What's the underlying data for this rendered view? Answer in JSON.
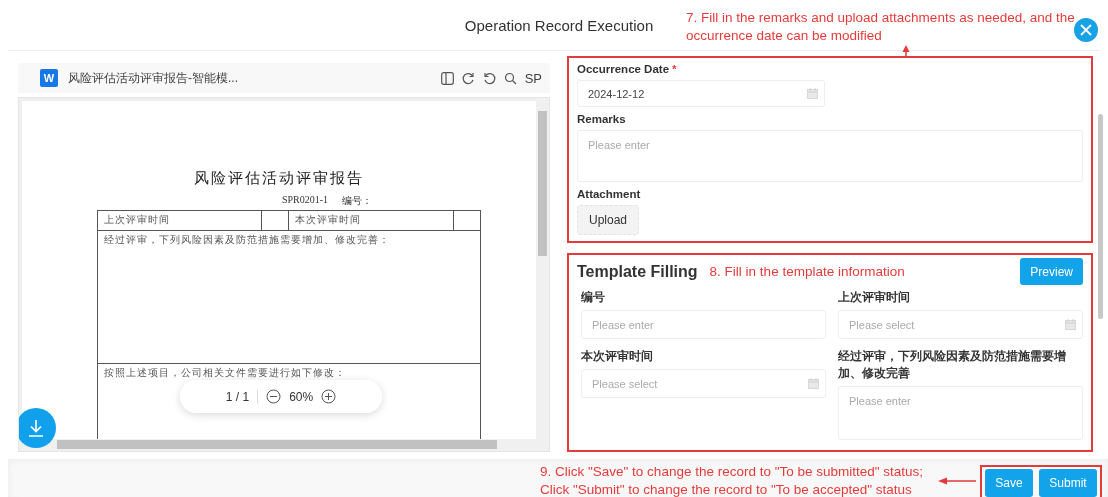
{
  "header": {
    "title": "Operation Record Execution",
    "annotation": [
      "7. Fill in the remarks and upload attachments as needed, and the",
      "occurrence date can be modified"
    ]
  },
  "viewer": {
    "file_icon_letter": "W",
    "file_name": "风险评估活动评审报告-智能模...",
    "toolbar_text": "SP",
    "document": {
      "title": "风险评估活动评审报告",
      "code": "SPR0201-1",
      "number_label": "编号：",
      "previous_review_label": "上次评审时间",
      "current_review_label": "本次评审时间",
      "review_text": "经过评审，下列风险因素及防范措施需要增加、修改完善：",
      "revision_text": "按照上述项目，公司相关文件需要进行如下修改："
    },
    "page_indicator": "1 / 1",
    "zoom": "60%"
  },
  "record_form": {
    "fields": [
      {
        "kind": "date",
        "label": "Occurrence Date",
        "required_mark": "*",
        "value": "2024-12-12"
      },
      {
        "kind": "textarea",
        "label": "Remarks",
        "placeholder": "Please enter"
      },
      {
        "kind": "upload",
        "label": "Attachment",
        "button": "Upload"
      }
    ]
  },
  "template": {
    "title": "Template Filling",
    "annotation": "8. Fill in the template information",
    "preview_button": "Preview",
    "fields": [
      {
        "kind": "text",
        "label": "编号",
        "placeholder": "Please enter"
      },
      {
        "kind": "date",
        "label": "上次评审时间",
        "placeholder": "Please select"
      },
      {
        "kind": "date",
        "label": "本次评审时间",
        "placeholder": "Please select"
      },
      {
        "kind": "textarea",
        "label": "经过评审，下列风险因素及防范措施需要增加、修改完善",
        "placeholder": "Please enter"
      }
    ]
  },
  "footer": {
    "annotation": [
      "9. Click \"Save\" to change the record to \"To be submitted\" status;",
      "Click \"Submit\" to change the record to \"To be accepted\" status"
    ],
    "buttons": [
      "Save",
      "Submit"
    ]
  }
}
